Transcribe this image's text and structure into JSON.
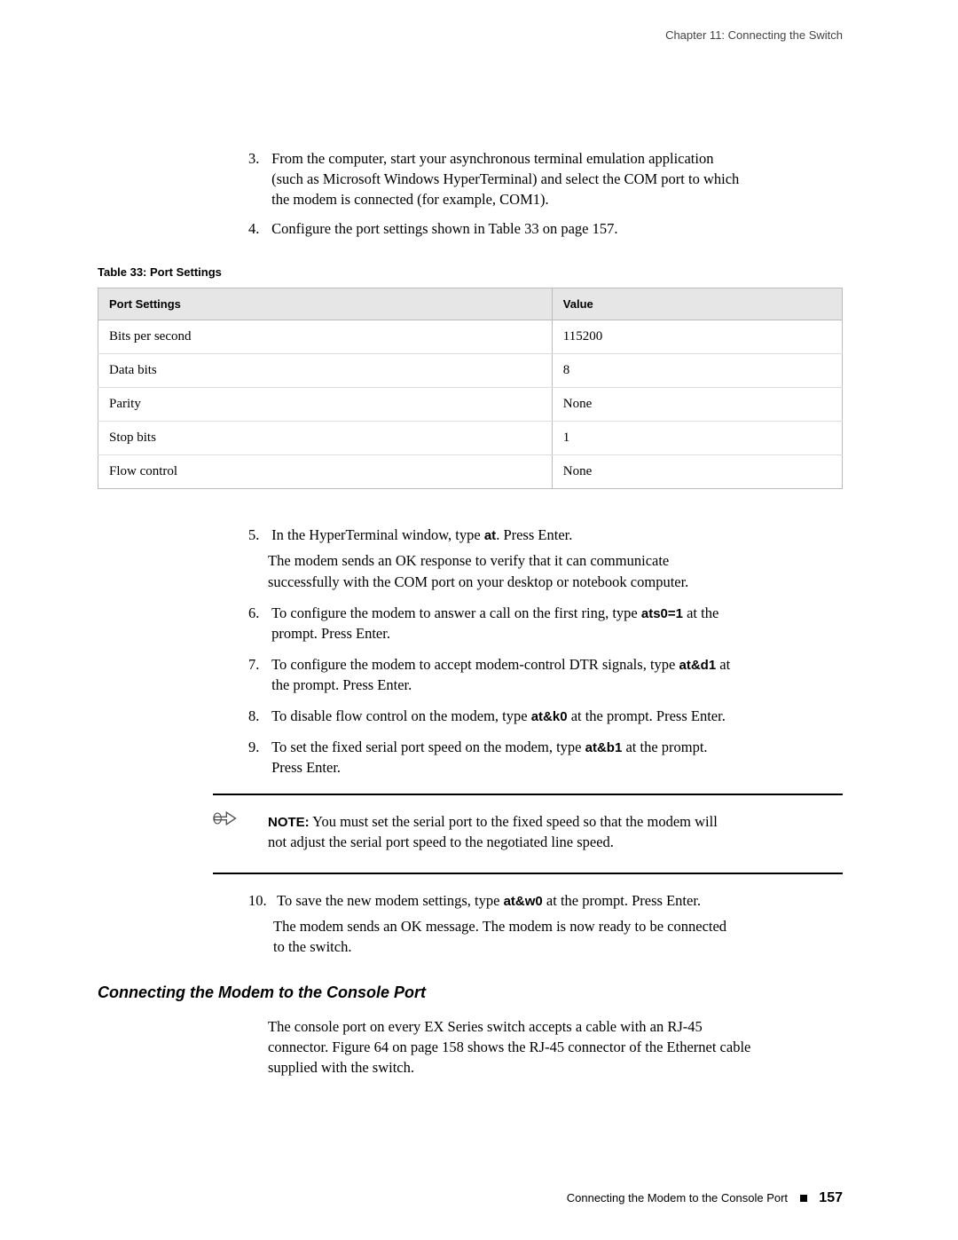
{
  "chapter_header": "Chapter 11: Connecting the Switch",
  "steps_top": [
    {
      "num": "3.",
      "text": "From the computer, start your asynchronous terminal emulation application (such as Microsoft Windows HyperTerminal) and select the COM port to which the modem is connected (for example, COM1)."
    },
    {
      "num": "4.",
      "text": "Configure the port settings shown in Table 33 on page 157."
    }
  ],
  "table": {
    "caption": "Table 33: Port Settings",
    "head_col1": "Port Settings",
    "head_col2": "Value",
    "rows": [
      {
        "k": "Bits per second",
        "v": "115200"
      },
      {
        "k": "Data bits",
        "v": "8"
      },
      {
        "k": "Parity",
        "v": "None"
      },
      {
        "k": "Stop bits",
        "v": "1"
      },
      {
        "k": "Flow control",
        "v": "None"
      }
    ]
  },
  "steps_mid": [
    {
      "num": "5.",
      "pre": "In the HyperTerminal window, type ",
      "cmd": "at",
      "post": ". Press Enter.",
      "sub": "The modem sends an OK response to verify that it can communicate successfully with the COM port on your desktop or notebook computer."
    },
    {
      "num": "6.",
      "pre": "To configure the modem to answer a call on the first ring, type ",
      "cmd": "ats0=1",
      "post": " at the prompt. Press Enter."
    },
    {
      "num": "7.",
      "pre": "To configure the modem to accept modem-control DTR signals, type ",
      "cmd": "at&d1",
      "post": " at the prompt. Press Enter."
    },
    {
      "num": "8.",
      "pre": "To disable flow control on the modem, type ",
      "cmd": "at&k0",
      "post": " at the prompt. Press Enter."
    },
    {
      "num": "9.",
      "pre": "To set the fixed serial port speed on the modem, type ",
      "cmd": "at&b1",
      "post": " at the prompt. Press Enter."
    }
  ],
  "note": {
    "label": "NOTE:",
    "text": " You must set the serial port to the fixed speed so that the modem will not adjust the serial port speed to the negotiated line speed."
  },
  "step10": {
    "num": "10.",
    "pre": "To save the new modem settings, type ",
    "cmd": "at&w0",
    "post": " at the prompt. Press Enter.",
    "sub": "The modem sends an OK message. The modem is now ready to be connected to the switch."
  },
  "section": {
    "head": "Connecting the Modem to the Console Port",
    "body": "The console port on every EX Series switch accepts a cable with an RJ-45 connector. Figure 64 on page 158 shows the RJ-45 connector of the Ethernet cable supplied with the switch."
  },
  "footer": {
    "text": "Connecting the Modem to the Console Port",
    "page": "157"
  }
}
